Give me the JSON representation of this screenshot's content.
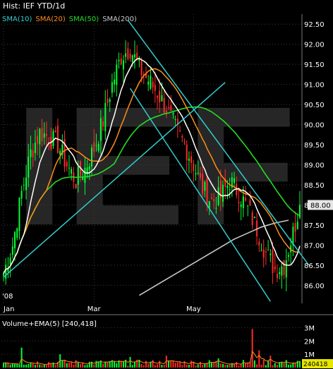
{
  "header": {
    "title": "Hist: IEF YTD/1d"
  },
  "watermark": "IEF",
  "colors": {
    "background": "#000000",
    "grid": "#3a3a3a",
    "up_candle": "#00ff33",
    "down_candle": "#ff2a2a",
    "sma10": "#ffffff",
    "sma20": "#ff8c1a",
    "sma50": "#22dd22",
    "sma200": "#c8c8c8",
    "trendline": "#33cccc",
    "price_tag_bg": "#e6e6e6",
    "watermark": "#555555"
  },
  "legend": [
    {
      "label": "SMA(10)",
      "color": "#33cccc"
    },
    {
      "label": "SMA(20)",
      "color": "#ff8c1a"
    },
    {
      "label": "SMA(50)",
      "color": "#22dd22"
    },
    {
      "label": "SMA(200)",
      "color": "#c8c8c8"
    }
  ],
  "price_tag": "88.00",
  "year_label": "'08",
  "volume_panel": {
    "legend_text": "Volume+EMA(5)",
    "legend_value": "[240,418]",
    "y_ticks": [
      "3M",
      "2M",
      "1M"
    ],
    "last_tag": "240418"
  },
  "chart_data": {
    "type": "candlestick",
    "title": "Hist: IEF YTD/1d",
    "x_tick_labels": [
      "Jan",
      "Mar",
      "May"
    ],
    "x_tick_index": [
      0,
      40,
      84
    ],
    "y_ticks": [
      "92.50",
      "92.00",
      "91.50",
      "91.00",
      "90.50",
      "90.00",
      "89.50",
      "89.00",
      "88.50",
      "88.00",
      "87.50",
      "87.00",
      "86.50",
      "86.00"
    ],
    "ylim": [
      85.55,
      92.75
    ],
    "volume_ylim": [
      0,
      3.5
    ],
    "last_price": 88.0,
    "last_volume": 240418,
    "trendlines": [
      {
        "from": [
          0,
          86.2
        ],
        "to": [
          98,
          91.05
        ]
      },
      {
        "from": [
          55,
          92.6
        ],
        "to": [
          135,
          86.5
        ]
      },
      {
        "from": [
          56,
          90.9
        ],
        "to": [
          118,
          85.6
        ]
      }
    ],
    "sma200": [
      [
        60,
        85.75
      ],
      [
        66,
        85.95
      ],
      [
        72,
        86.15
      ],
      [
        78,
        86.35
      ],
      [
        84,
        86.55
      ],
      [
        90,
        86.75
      ],
      [
        96,
        86.95
      ],
      [
        102,
        87.15
      ],
      [
        108,
        87.3
      ],
      [
        114,
        87.45
      ],
      [
        120,
        87.55
      ],
      [
        126,
        87.62
      ]
    ]
  }
}
